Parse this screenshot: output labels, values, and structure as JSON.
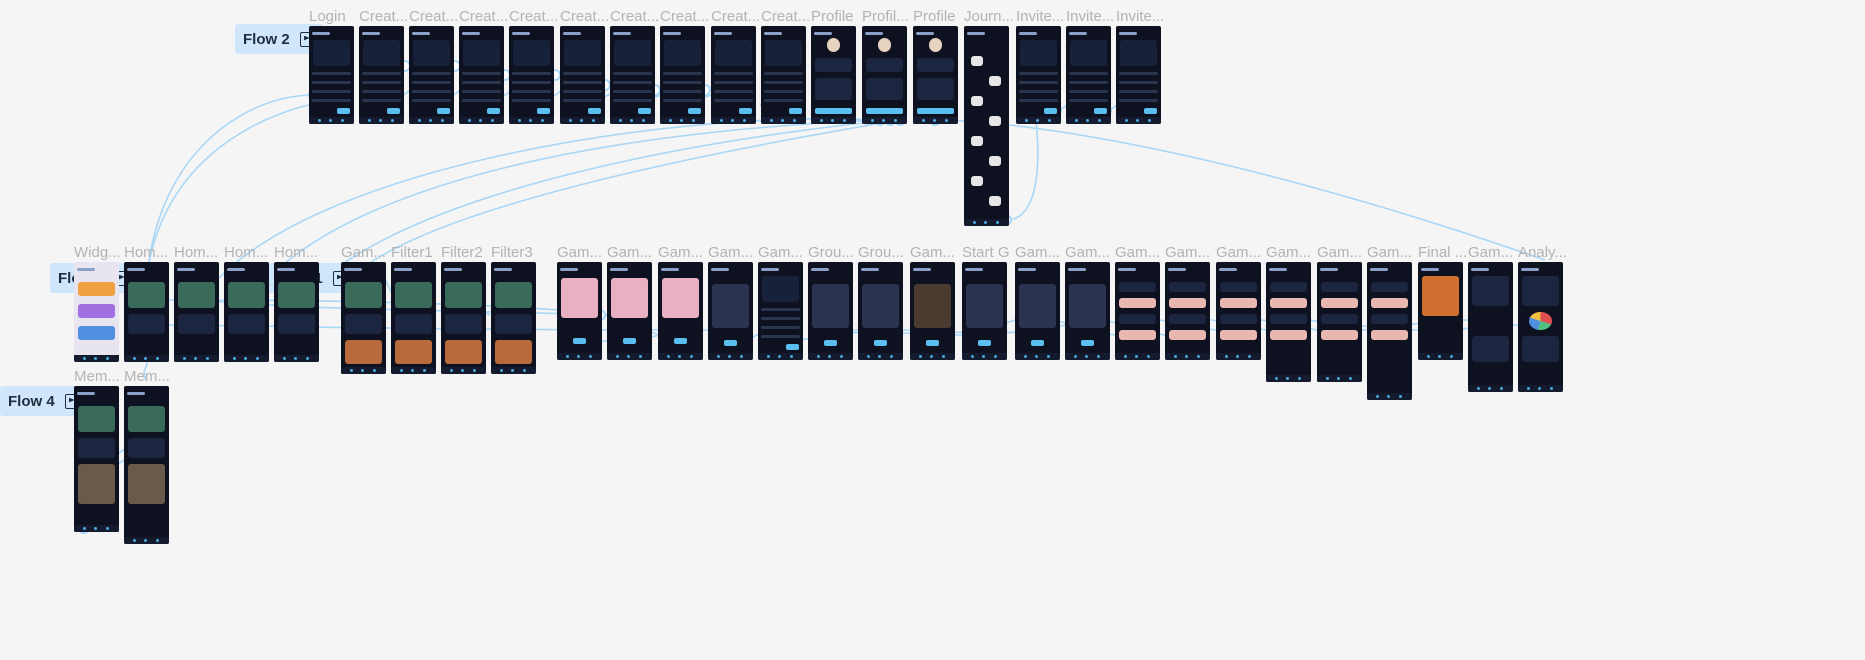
{
  "canvas": {
    "background": "#f5f5f5",
    "wire_color": "#a9d7f7",
    "accent": "#5bbef0",
    "screen_bg": "#0d1120"
  },
  "flows": [
    {
      "label": "Flow 2",
      "icon": "play-frame-icon"
    },
    {
      "label": "Flow 3",
      "icon": "play-frame-icon"
    },
    {
      "label": "Flow 1",
      "icon": "play-frame-icon"
    },
    {
      "label": "Flow 4",
      "icon": "play-frame-icon"
    }
  ],
  "frames": [
    {
      "label": "Login",
      "kind": "login"
    },
    {
      "label": "Creat...",
      "kind": "form"
    },
    {
      "label": "Creat...",
      "kind": "form"
    },
    {
      "label": "Creat...",
      "kind": "form"
    },
    {
      "label": "Creat...",
      "kind": "form"
    },
    {
      "label": "Creat...",
      "kind": "form"
    },
    {
      "label": "Creat...",
      "kind": "form"
    },
    {
      "label": "Creat...",
      "kind": "form"
    },
    {
      "label": "Creat...",
      "kind": "form"
    },
    {
      "label": "Creat...",
      "kind": "form"
    },
    {
      "label": "Profile",
      "kind": "profile"
    },
    {
      "label": "Profil...",
      "kind": "profile"
    },
    {
      "label": "Profile",
      "kind": "profile"
    },
    {
      "label": "Journ...",
      "kind": "journey"
    },
    {
      "label": "Invite...",
      "kind": "invite"
    },
    {
      "label": "Invite...",
      "kind": "invite"
    },
    {
      "label": "Invite...",
      "kind": "invite"
    },
    {
      "label": "Widg...",
      "kind": "widget"
    },
    {
      "label": "Hom...",
      "kind": "home"
    },
    {
      "label": "Hom...",
      "kind": "home"
    },
    {
      "label": "Hom...",
      "kind": "home"
    },
    {
      "label": "Hom...",
      "kind": "home"
    },
    {
      "label": "Gam...",
      "kind": "gallery"
    },
    {
      "label": "Filter1",
      "kind": "gallery"
    },
    {
      "label": "Filter2",
      "kind": "gallery"
    },
    {
      "label": "Filter3",
      "kind": "gallery"
    },
    {
      "label": "Gam...",
      "kind": "mode"
    },
    {
      "label": "Gam...",
      "kind": "mode"
    },
    {
      "label": "Gam...",
      "kind": "mode"
    },
    {
      "label": "Gam...",
      "kind": "plain"
    },
    {
      "label": "Gam...",
      "kind": "invite"
    },
    {
      "label": "Grou...",
      "kind": "upload"
    },
    {
      "label": "Grou...",
      "kind": "upload"
    },
    {
      "label": "Gam...",
      "kind": "photo"
    },
    {
      "label": "Start G",
      "kind": "upload"
    },
    {
      "label": "Gam...",
      "kind": "plain"
    },
    {
      "label": "Gam...",
      "kind": "plain"
    },
    {
      "label": "Gam...",
      "kind": "chat"
    },
    {
      "label": "Gam...",
      "kind": "chat"
    },
    {
      "label": "Gam...",
      "kind": "chat"
    },
    {
      "label": "Gam...",
      "kind": "chat"
    },
    {
      "label": "Gam...",
      "kind": "chat"
    },
    {
      "label": "Gam...",
      "kind": "chat"
    },
    {
      "label": "Final ...",
      "kind": "final"
    },
    {
      "label": "Gam...",
      "kind": "results"
    },
    {
      "label": "Analy...",
      "kind": "analytics"
    },
    {
      "label": "Mem...",
      "kind": "memories"
    },
    {
      "label": "Mem...",
      "kind": "memories"
    }
  ]
}
